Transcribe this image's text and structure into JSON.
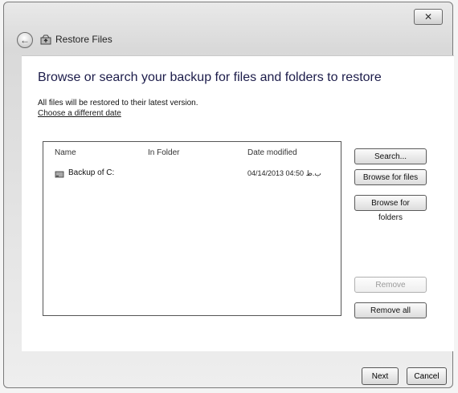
{
  "window": {
    "title": "Restore Files",
    "close_label": "✕"
  },
  "main": {
    "heading": "Browse or search your backup for files and folders to restore",
    "info": "All files will be restored to their latest version.",
    "change_date_link": "Choose a different date"
  },
  "file_list": {
    "columns": [
      "Name",
      "In Folder",
      "Date modified"
    ],
    "rows": [
      {
        "name": "Backup of C:",
        "folder": "",
        "date": "04/14/2013 04:50 ب.ظ"
      }
    ]
  },
  "side_buttons": {
    "search": "Search...",
    "browse_files": "Browse for files",
    "browse_folders": "Browse for folders",
    "remove": "Remove",
    "remove_all": "Remove all"
  },
  "footer": {
    "next": "Next",
    "cancel": "Cancel"
  },
  "icons": {
    "back": "back-arrow-icon",
    "app": "restore-files-icon",
    "close": "close-icon",
    "file": "drive-icon"
  }
}
